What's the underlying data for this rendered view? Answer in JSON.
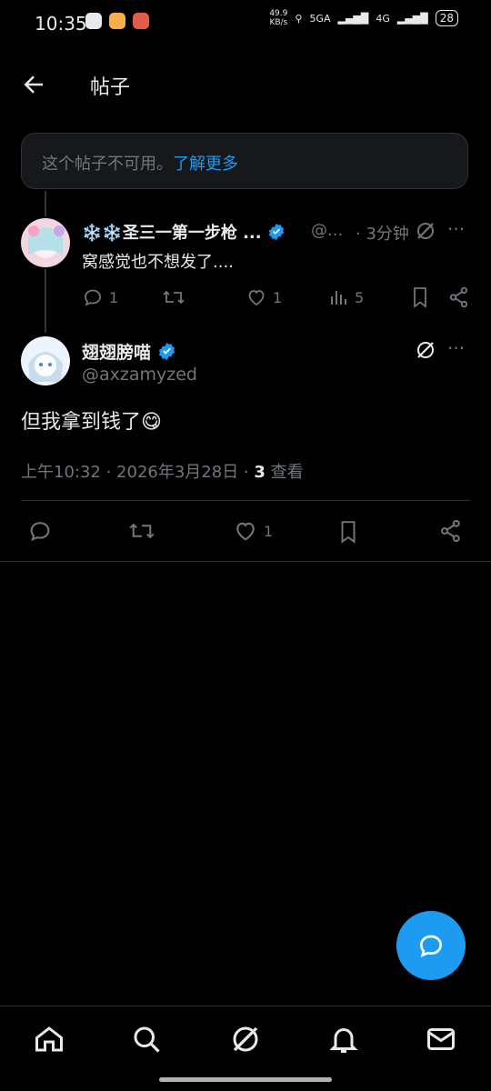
{
  "status_bar": {
    "time": "10:35",
    "net_speed_value": "49.9",
    "net_speed_unit": "KB/s",
    "net_5g": "5GA",
    "net_4g": "4G",
    "battery": "28"
  },
  "header": {
    "title": "帖子"
  },
  "notice": {
    "text": "这个帖子不可用。",
    "link": "了解更多"
  },
  "reply": {
    "name": "❄️❄️圣三一第一步枪 ...",
    "handle": "@...",
    "dot": "·",
    "time": "3分钟",
    "body": "窝感觉也不想发了....",
    "replies": "1",
    "likes": "1",
    "views": "5"
  },
  "post": {
    "name": "翅翅膀喵",
    "handle": "@axzamyzed",
    "body": "但我拿到钱了😋",
    "time": "上午10:32 · 2026年3月28日 · ",
    "views_count": "3",
    "views_label": " 查看",
    "likes": "1"
  },
  "colors": {
    "accent": "#1d9bf0",
    "muted": "#71767b",
    "background": "#000000"
  }
}
